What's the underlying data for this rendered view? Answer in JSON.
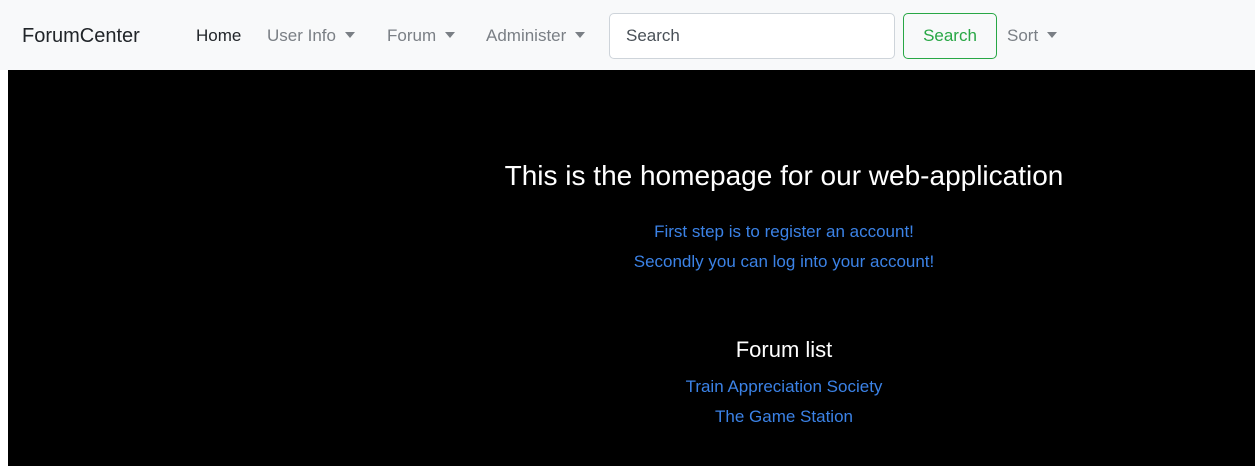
{
  "navbar": {
    "brand": "ForumCenter",
    "items": [
      {
        "label": "Home",
        "active": true,
        "dropdown": false
      },
      {
        "label": "User Info",
        "active": false,
        "dropdown": true
      },
      {
        "label": "Forum",
        "active": false,
        "dropdown": true
      },
      {
        "label": "Administer",
        "active": false,
        "dropdown": true
      }
    ],
    "search": {
      "placeholder": "Search",
      "value": "",
      "button_label": "Search"
    },
    "sort": {
      "label": "Sort",
      "dropdown": true
    }
  },
  "main": {
    "headline": "This is the homepage for our web-application",
    "links": [
      "First step is to register an account!",
      "Secondly you can log into your account!"
    ],
    "forum_list": {
      "title": "Forum list",
      "forums": [
        "Train Appreciation Society",
        "The Game Station"
      ]
    }
  },
  "colors": {
    "navbar_bg": "#f8f9fa",
    "main_bg": "#000000",
    "link": "#3b82e6",
    "success": "#28a745"
  }
}
